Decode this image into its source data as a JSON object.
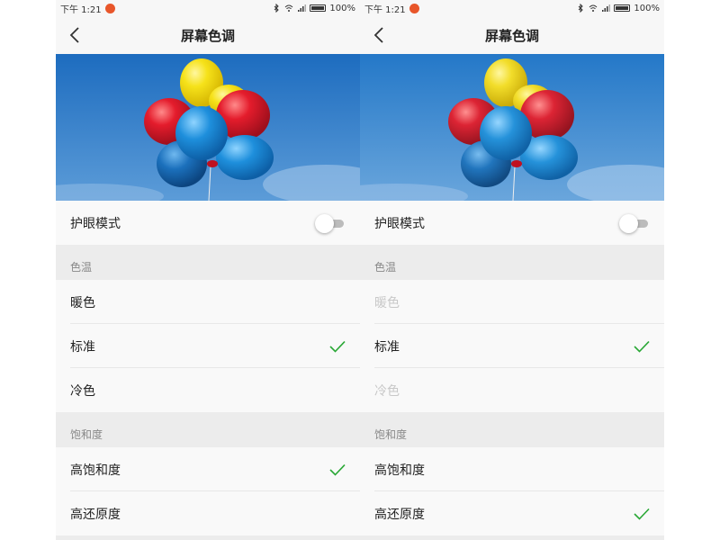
{
  "status_bar": {
    "time": "下午 1:21",
    "battery": "100%"
  },
  "screens": [
    {
      "title": "屏幕色调",
      "eye_mode_label": "护眼模式",
      "eye_mode_on": false,
      "color_temp_header": "色温",
      "color_temp": [
        {
          "label": "暖色",
          "selected": false,
          "disabled": false
        },
        {
          "label": "标准",
          "selected": true,
          "disabled": false
        },
        {
          "label": "冷色",
          "selected": false,
          "disabled": false
        }
      ],
      "saturation_header": "饱和度",
      "saturation": [
        {
          "label": "高饱和度",
          "selected": true
        },
        {
          "label": "高还原度",
          "selected": false
        }
      ]
    },
    {
      "title": "屏幕色调",
      "eye_mode_label": "护眼模式",
      "eye_mode_on": false,
      "color_temp_header": "色温",
      "color_temp": [
        {
          "label": "暖色",
          "selected": false,
          "disabled": true
        },
        {
          "label": "标准",
          "selected": true,
          "disabled": false
        },
        {
          "label": "冷色",
          "selected": false,
          "disabled": true
        }
      ],
      "saturation_header": "饱和度",
      "saturation": [
        {
          "label": "高饱和度",
          "selected": false
        },
        {
          "label": "高还原度",
          "selected": true
        }
      ]
    }
  ],
  "colors": {
    "check": "#2aa836",
    "sky_top": "#1f6fc0",
    "sky_bottom": "#7fb2e0"
  },
  "icons": {
    "back": "chevron-left-icon",
    "check": "checkmark-icon",
    "bluetooth": "bluetooth-icon",
    "wifi": "wifi-icon",
    "signal": "signal-icon",
    "battery": "battery-icon"
  }
}
